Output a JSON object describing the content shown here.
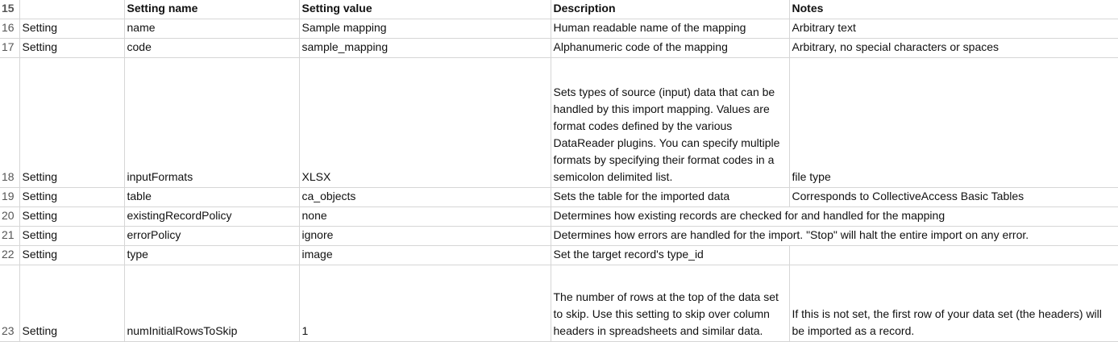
{
  "rows": [
    {
      "num": "15",
      "a": "",
      "b": "Setting name",
      "c": "Setting value",
      "d": "Description",
      "e": "Notes"
    },
    {
      "num": "16",
      "a": "Setting",
      "b": "name",
      "c": "Sample mapping",
      "d": "Human readable name of the mapping",
      "e": "Arbitrary text"
    },
    {
      "num": "17",
      "a": "Setting",
      "b": "code",
      "c": "sample_mapping",
      "d": "Alphanumeric code of the mapping",
      "e": "Arbitrary, no special characters or spaces"
    },
    {
      "num": "18",
      "a": "Setting",
      "b": "inputFormats",
      "c": "XLSX",
      "d": "Sets types of source (input) data that can be handled by this import mapping. Values are format codes defined by the various DataReader plugins. You can specify multiple formats by specifying their format codes in a semicolon delimited list.",
      "e": "file type"
    },
    {
      "num": "19",
      "a": "Setting",
      "b": "table",
      "c": "ca_objects",
      "d": "Sets the table for the imported data",
      "e": "Corresponds to CollectiveAccess Basic Tables"
    },
    {
      "num": "20",
      "a": "Setting",
      "b": "existingRecordPolicy",
      "c": "none",
      "d": "Determines how existing records are checked for and handled for the mapping",
      "e": ""
    },
    {
      "num": "21",
      "a": "Setting",
      "b": "errorPolicy",
      "c": "ignore",
      "d": "Determines how errors are handled for the import. \"Stop\" will halt the entire import on any error.",
      "e": ""
    },
    {
      "num": "22",
      "a": "Setting",
      "b": "type",
      "c": "image",
      "d": "Set the target record's type_id",
      "e": ""
    },
    {
      "num": "23",
      "a": "Setting",
      "b": "numInitialRowsToSkip",
      "c": "1",
      "d": "The number of rows at the top of the data set to skip. Use this setting to skip over column headers in spreadsheets and similar data.",
      "e": "If this is not set, the first row of your data set (the headers) will be imported as a record."
    }
  ]
}
